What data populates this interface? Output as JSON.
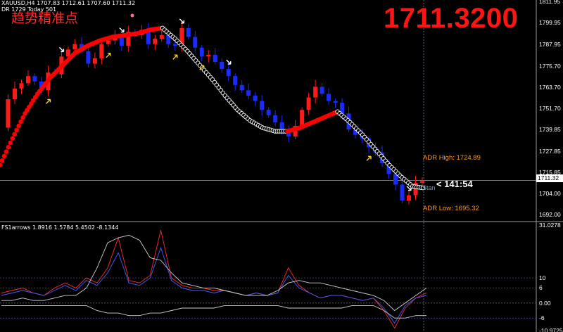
{
  "header": {
    "line1": "XAUUSD,H4  1707.83 1712.61 1707.60 1711.32",
    "line2": "DR 1729  Today 501",
    "indicator_title": "FS1arrows 1.8916 1.5784 5.4502 -8.1344"
  },
  "watermark_cn": "趋势精准点",
  "big_price": "1711.3200",
  "adr": {
    "high": "ADR High: 1724.89",
    "low": "ADR Low: 1695.32"
  },
  "timer": "< 141:54",
  "timer_label": "Stan",
  "current_price_label": "1711.32",
  "colors": {
    "bull": "#ff1a1a",
    "bear": "#1a2bff",
    "trend_up": "#ff0000",
    "trend_down": "#ffffff",
    "adr": "#ff9a1e",
    "arrow_up": "#ffd21e"
  },
  "chart_data": [
    {
      "type": "candlestick",
      "symbol": "XAUUSD",
      "timeframe": "H4",
      "ylim": [
        1689,
        1812
      ],
      "y_ticks": [
        "1811.95",
        "1799.95",
        "1787.95",
        "1775.70",
        "1763.70",
        "1751.70",
        "1739.85",
        "1727.85",
        "1715.85",
        "1704.00",
        "1692.00"
      ],
      "close_path": [
        1741,
        1757,
        1763,
        1766,
        1770,
        1767,
        1762,
        1772,
        1771,
        1781,
        1785,
        1788,
        1784,
        1777,
        1780,
        1788,
        1790,
        1792,
        1787,
        1795,
        1793,
        1796,
        1788,
        1791,
        1793,
        1788,
        1787,
        1797,
        1792,
        1786,
        1781,
        1782,
        1778,
        1774,
        1770,
        1765,
        1762,
        1759,
        1756,
        1751,
        1748,
        1744,
        1740,
        1736,
        1742,
        1751,
        1758,
        1764,
        1760,
        1756,
        1755,
        1749,
        1740,
        1737,
        1735,
        1730,
        1727,
        1721,
        1715,
        1709,
        1700,
        1703,
        1710,
        1711
      ],
      "trend_line": [
        {
          "dir": "up",
          "values": [
            1720,
            1735,
            1749,
            1760,
            1769,
            1776,
            1783,
            1787,
            1790,
            1792,
            1793,
            1794,
            1796,
            1797
          ]
        },
        {
          "dir": "down",
          "values": [
            1797,
            1791,
            1784,
            1776,
            1768,
            1759,
            1751,
            1745,
            1741,
            1739,
            1739
          ]
        },
        {
          "dir": "up",
          "values": [
            1739,
            1741,
            1744,
            1747,
            1750
          ]
        },
        {
          "dir": "down",
          "values": [
            1750,
            1744,
            1737,
            1729,
            1721,
            1714,
            1708,
            1707
          ]
        }
      ],
      "arrows_up": [
        7,
        16,
        26,
        30,
        55,
        73
      ],
      "arrows_down": [
        9,
        18,
        27,
        34,
        61,
        74
      ]
    },
    {
      "type": "line",
      "title": "FS1arrows",
      "ylim": [
        -10.9725,
        31.0278
      ],
      "y_ticks": [
        "31.0278",
        "10",
        "6",
        "0.00",
        "-6",
        "-10.9725"
      ],
      "series": [
        {
          "color": "#ff2a2a",
          "values": [
            4,
            5,
            6,
            4,
            3,
            6,
            8,
            6,
            10,
            8,
            14,
            26,
            9,
            8,
            11,
            29,
            10,
            7,
            6,
            6,
            5,
            5,
            4,
            3,
            4,
            3,
            4,
            14,
            7,
            4,
            2,
            3,
            3,
            2,
            1,
            2,
            -3,
            -10,
            -2,
            2,
            4
          ]
        },
        {
          "color": "#4a5cff",
          "values": [
            3,
            4,
            5,
            4,
            3,
            5,
            7,
            5,
            9,
            7,
            12,
            20,
            8,
            7,
            10,
            22,
            9,
            6,
            5,
            5,
            4,
            5,
            4,
            3,
            4,
            3,
            4,
            11,
            6,
            4,
            2,
            3,
            3,
            2,
            1,
            2,
            -2,
            -8,
            -1,
            2,
            3
          ]
        },
        {
          "color": "#cfcfcf",
          "values": [
            1,
            1,
            2,
            1,
            1,
            2,
            3,
            3,
            6,
            14,
            24,
            26,
            27,
            25,
            18,
            17,
            12,
            8,
            7,
            6,
            6,
            5,
            4,
            3,
            3,
            3,
            5,
            8,
            9,
            8,
            8,
            7,
            6,
            5,
            4,
            3,
            1,
            -3,
            0,
            3,
            6
          ]
        },
        {
          "color": "#cfcfcf",
          "values": [
            -1,
            -1,
            -1,
            -1,
            -1,
            -1,
            -1,
            -1,
            -1,
            -3,
            -4,
            -4,
            -5,
            -5,
            -4,
            -4,
            -3,
            -2,
            -2,
            -2,
            -2,
            -1,
            -1,
            -1,
            -1,
            -1,
            -1,
            -2,
            -2,
            -2,
            -2,
            -2,
            -2,
            -1,
            -1,
            -1,
            -3,
            -6,
            -6,
            -5,
            -5
          ]
        }
      ]
    }
  ]
}
